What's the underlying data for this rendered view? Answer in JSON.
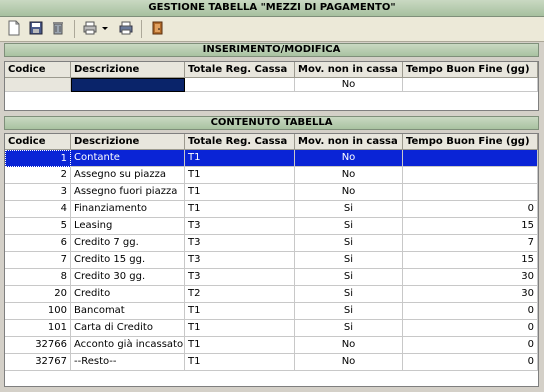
{
  "window": {
    "title": "GESTIONE TABELLA \"MEZZI DI PAGAMENTO\""
  },
  "toolbar": {
    "icons": [
      "new-document-icon",
      "save-icon",
      "delete-icon",
      "print-icon",
      "dropdown-arrow-icon",
      "print-preview-icon",
      "exit-door-icon"
    ]
  },
  "edit_section": {
    "title": "INSERIMENTO/MODIFICA",
    "columns": [
      "Codice",
      "Descrizione",
      "Totale Reg. Cassa",
      "Mov. non in cassa",
      "Tempo Buon Fine (gg)"
    ],
    "values": {
      "codice": "",
      "descrizione": "",
      "totale": "",
      "mov": "No",
      "tempo": ""
    }
  },
  "table_section": {
    "title": "CONTENUTO TABELLA",
    "columns": [
      "Codice",
      "Descrizione",
      "Totale Reg. Cassa",
      "Mov. non in cassa",
      "Tempo Buon Fine (gg)"
    ],
    "rows": [
      {
        "codice": "1",
        "descrizione": "Contante",
        "totale": "T1",
        "mov": "No",
        "tempo": ""
      },
      {
        "codice": "2",
        "descrizione": "Assegno su piazza",
        "totale": "T1",
        "mov": "No",
        "tempo": ""
      },
      {
        "codice": "3",
        "descrizione": "Assegno fuori piazza",
        "totale": "T1",
        "mov": "No",
        "tempo": ""
      },
      {
        "codice": "4",
        "descrizione": "Finanziamento",
        "totale": "T1",
        "mov": "Si",
        "tempo": "0"
      },
      {
        "codice": "5",
        "descrizione": "Leasing",
        "totale": "T3",
        "mov": "Si",
        "tempo": "15"
      },
      {
        "codice": "6",
        "descrizione": "Credito 7 gg.",
        "totale": "T3",
        "mov": "Si",
        "tempo": "7"
      },
      {
        "codice": "7",
        "descrizione": "Credito 15 gg.",
        "totale": "T3",
        "mov": "Si",
        "tempo": "15"
      },
      {
        "codice": "8",
        "descrizione": "Credito 30 gg.",
        "totale": "T3",
        "mov": "Si",
        "tempo": "30"
      },
      {
        "codice": "20",
        "descrizione": "Credito",
        "totale": "T2",
        "mov": "Si",
        "tempo": "30"
      },
      {
        "codice": "100",
        "descrizione": "Bancomat",
        "totale": "T1",
        "mov": "Si",
        "tempo": "0"
      },
      {
        "codice": "101",
        "descrizione": "Carta di Credito",
        "totale": "T1",
        "mov": "Si",
        "tempo": "0"
      },
      {
        "codice": "32766",
        "descrizione": "Acconto già incassato",
        "totale": "T1",
        "mov": "No",
        "tempo": "0"
      },
      {
        "codice": "32767",
        "descrizione": "--Resto--",
        "totale": "T1",
        "mov": "No",
        "tempo": "0"
      }
    ],
    "selected_index": 0
  }
}
